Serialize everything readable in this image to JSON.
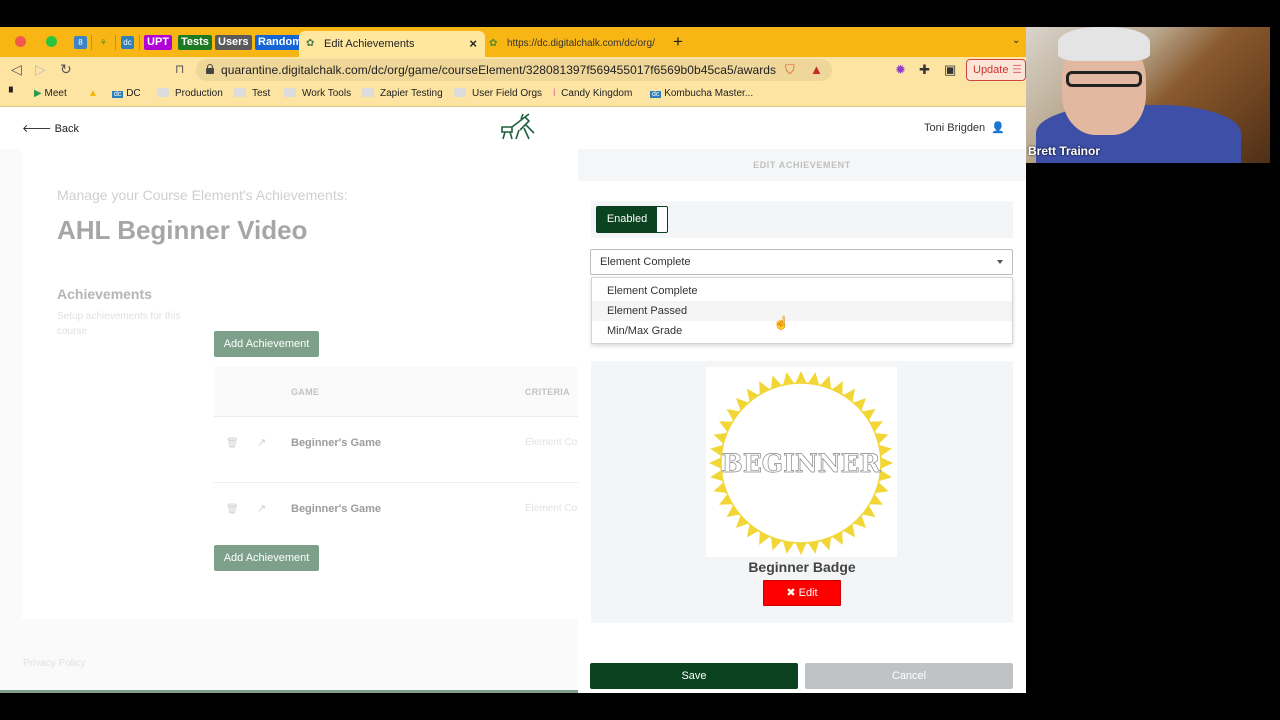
{
  "browser": {
    "pinned_tabs": [
      {
        "label": "UPT",
        "color": "#b100d6"
      },
      {
        "label": "Tests",
        "color": "#1d7a22"
      },
      {
        "label": "Users",
        "color": "#5a5a5a"
      },
      {
        "label": "Random",
        "color": "#1565d6"
      }
    ],
    "active_tab": {
      "title": "Edit Achievements"
    },
    "second_tab": {
      "title": "https://dc.digitalchalk.com/dc/org/"
    },
    "url": "quarantine.digitalchalk.com/dc/org/game/courseElement/328081397f569455017f6569b0b45ca5/awards",
    "update_label": "Update",
    "brave_badge": "1",
    "alert_badge": "1",
    "bookmarks": [
      {
        "label": "Meet",
        "icon": "meet-icon"
      },
      {
        "label": "DC",
        "icon": "dc-icon"
      },
      {
        "label": "Production",
        "icon": "folder-icon"
      },
      {
        "label": "Test",
        "icon": "folder-icon"
      },
      {
        "label": "Work Tools",
        "icon": "folder-icon"
      },
      {
        "label": "Zapier Testing",
        "icon": "folder-icon"
      },
      {
        "label": "User Field Orgs",
        "icon": "folder-icon"
      },
      {
        "label": "Candy Kingdom",
        "icon": "candy-icon"
      },
      {
        "label": "Kombucha Master...",
        "icon": "dc-icon"
      }
    ]
  },
  "header": {
    "back_label": "Back",
    "user_name": "Toni Brigden"
  },
  "main": {
    "subtitle": "Manage your Course Element's Achievements:",
    "title": "AHL Beginner Video",
    "section_heading": "Achievements",
    "section_desc": "Setup achievements for this course",
    "add_button_label": "Add Achievement",
    "table": {
      "columns": [
        "GAME",
        "CRITERIA"
      ],
      "rows": [
        {
          "game": "Beginner's Game",
          "criteria": "Element Complete"
        },
        {
          "game": "Beginner's Game",
          "criteria": "Element Complete"
        }
      ]
    },
    "privacy_label": "Privacy Policy"
  },
  "panel": {
    "header": "EDIT ACHIEVEMENT",
    "toggle_label": "Enabled",
    "toggle_on": true,
    "criteria_selected": "Element Complete",
    "criteria_options": [
      "Element Complete",
      "Element Passed",
      "Min/Max Grade"
    ],
    "hovered_option": "Element Passed",
    "badge_text": "BEGINNER",
    "badge_name": "Beginner Badge",
    "badge_edit_label": "Edit",
    "save_label": "Save",
    "cancel_label": "Cancel"
  },
  "webcam": {
    "participant_name": "Brett Trainor"
  },
  "colors": {
    "brand_green": "#0b4320",
    "muted_green": "#7ea08b",
    "danger_red": "#ff0000",
    "badge_yellow": "#f2d635"
  }
}
